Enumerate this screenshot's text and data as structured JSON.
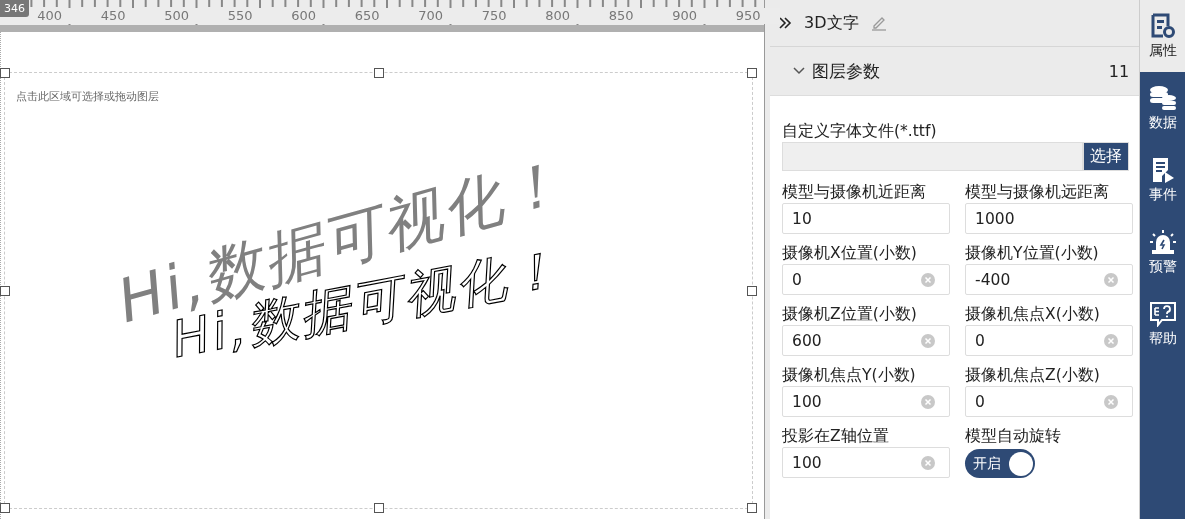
{
  "ruler": {
    "badge": "346",
    "labels": [
      "400",
      "450",
      "500",
      "550",
      "600",
      "650",
      "700",
      "750",
      "800",
      "850",
      "900",
      "950"
    ]
  },
  "canvas": {
    "hint": "点击此区域可选择或拖动图层",
    "shadow_text": "Hi,数据可视化！",
    "outline_text": "Hi,数据可视化！"
  },
  "panel": {
    "title": "3D文字",
    "section": {
      "title": "图层参数",
      "count": "11",
      "expanded": true
    },
    "font_file": {
      "label": "自定义字体文件(*.ttf)",
      "button": "选择"
    },
    "fields": [
      {
        "label": "模型与摄像机近距离",
        "value": "10",
        "clearable": false
      },
      {
        "label": "模型与摄像机远距离",
        "value": "1000",
        "clearable": false
      },
      {
        "label": "摄像机X位置(小数)",
        "value": "0",
        "clearable": true
      },
      {
        "label": "摄像机Y位置(小数)",
        "value": "-400",
        "clearable": true
      },
      {
        "label": "摄像机Z位置(小数)",
        "value": "600",
        "clearable": true
      },
      {
        "label": "摄像机焦点X(小数)",
        "value": "0",
        "clearable": true
      },
      {
        "label": "摄像机焦点Y(小数)",
        "value": "100",
        "clearable": true
      },
      {
        "label": "摄像机焦点Z(小数)",
        "value": "0",
        "clearable": true
      },
      {
        "label": "投影在Z轴位置",
        "value": "100",
        "clearable": true
      }
    ],
    "toggle": {
      "label": "模型自动旋转",
      "on": true,
      "text": "开启"
    }
  },
  "sidebar": [
    {
      "kind": "properties",
      "label": "属性",
      "selected": true
    },
    {
      "kind": "data",
      "label": "数据",
      "selected": false
    },
    {
      "kind": "events",
      "label": "事件",
      "selected": false
    },
    {
      "kind": "alert",
      "label": "预警",
      "selected": false
    },
    {
      "kind": "help",
      "label": "帮助",
      "selected": false
    }
  ]
}
